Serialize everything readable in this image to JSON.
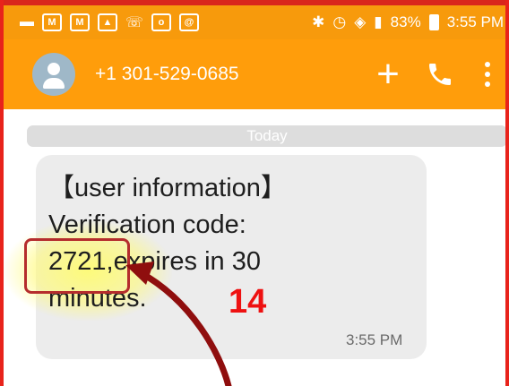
{
  "status_bar": {
    "battery": "83%",
    "time": "3:55 PM"
  },
  "conversation": {
    "contact": "+1 301-529-0685",
    "date_divider": "Today",
    "message": {
      "text": "【user information】\nVerification code:\n2721,expires in 30\nminutes.",
      "time": "3:55 PM"
    }
  },
  "annotation": {
    "step_number": "14",
    "color": "#ee1111"
  },
  "colors": {
    "app_bar": "#ff9d0b",
    "status_bar": "#f79a0c",
    "frame": "#e8231b"
  }
}
